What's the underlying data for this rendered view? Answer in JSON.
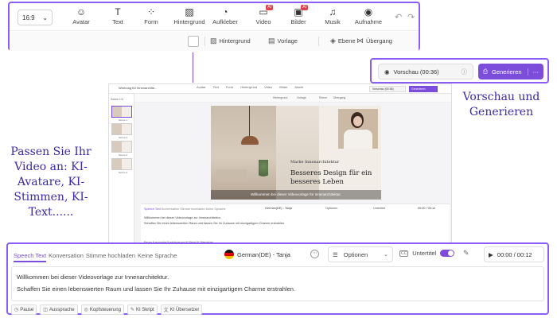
{
  "toolbar": {
    "aspect_ratio": "16:9",
    "tools": [
      {
        "label": "Avatar",
        "icon": "avatar-icon"
      },
      {
        "label": "Text",
        "icon": "text-icon"
      },
      {
        "label": "Form",
        "icon": "shapes-icon"
      },
      {
        "label": "Hintergrund",
        "icon": "background-icon"
      },
      {
        "label": "Aufkleber",
        "icon": "sticker-icon"
      },
      {
        "label": "Video",
        "icon": "video-icon",
        "badge": "AI"
      },
      {
        "label": "Bilder",
        "icon": "image-icon",
        "badge": "AI"
      },
      {
        "label": "Musik",
        "icon": "music-icon"
      },
      {
        "label": "Aufnahme",
        "icon": "record-icon"
      }
    ],
    "secondary": {
      "background": "Hintergrund",
      "template": "Vorlage",
      "layer": "Ebene",
      "transition": "Übergang"
    }
  },
  "header_actions": {
    "preview_label": "Vorschau (00:36)",
    "generate_label": "Generieren"
  },
  "annotations": {
    "right": "Vorschau und Generieren",
    "left": "Passen Sie Ihr Video an: KI-Avatare, KI-Stimmen, KI-Text......"
  },
  "mini_editor": {
    "title": "Werbung für Innenarchite...",
    "preview_label": "Vorschau (00:36)",
    "generate_label": "Generieren",
    "scene_header": "Szene 1/4",
    "scenes": [
      "Szene 1",
      "Szene 2",
      "Szene 3",
      "Szene 4"
    ],
    "canvas_tag": "Marke Innenarchitektur",
    "canvas_headline": "Besseres Design für ein besseres Leben",
    "canvas_caption": "Willkommen bei dieser Videovorlage für Innenarchitektur.",
    "panel_tabs": [
      "Speech Text",
      "Konversation",
      "Stimme hochladen",
      "Keine Sprache"
    ],
    "voice": "German(DE) - Tanja",
    "options": "Optionen",
    "subtitle": "Untertitel",
    "time": "00:00 / 00:12",
    "script_lines": [
      "Willkommen bei dieser Videovorlage zur Innenarchitektur.",
      "Schaffen Sie einen lebenswerten Raum und lassen Sie Ihr Zuhause mit einzigartigem Charme erstrahlen."
    ],
    "chips": [
      "Pause",
      "Aussprache",
      "Kopfsteuerung",
      "KI Skript",
      "KI Übersetzer"
    ]
  },
  "script_panel": {
    "tabs": [
      "Speech Text",
      "Konversation",
      "Stimme hochladen",
      "Keine Sprache"
    ],
    "voice": "German(DE) - Tanja",
    "options_label": "Optionen",
    "subtitle_label": "Untertitel",
    "subtitle_on": true,
    "time": "00:00 / 00:12",
    "script_lines": [
      "Willkommen bei dieser Videovorlage zur Innenarchitektur.",
      "Schaffen Sie einen lebenswerten Raum und lassen Sie Ihr Zuhause mit einzigartigem Charme erstrahlen."
    ],
    "chips": [
      "Pause",
      "Aussprache",
      "Kopfsteuerung",
      "KI Skript",
      "KI Übersetzer"
    ]
  },
  "colors": {
    "accent": "#7c4ddb",
    "callout_border": "#8b5cf6",
    "annotation_text": "#3a2aa6"
  }
}
